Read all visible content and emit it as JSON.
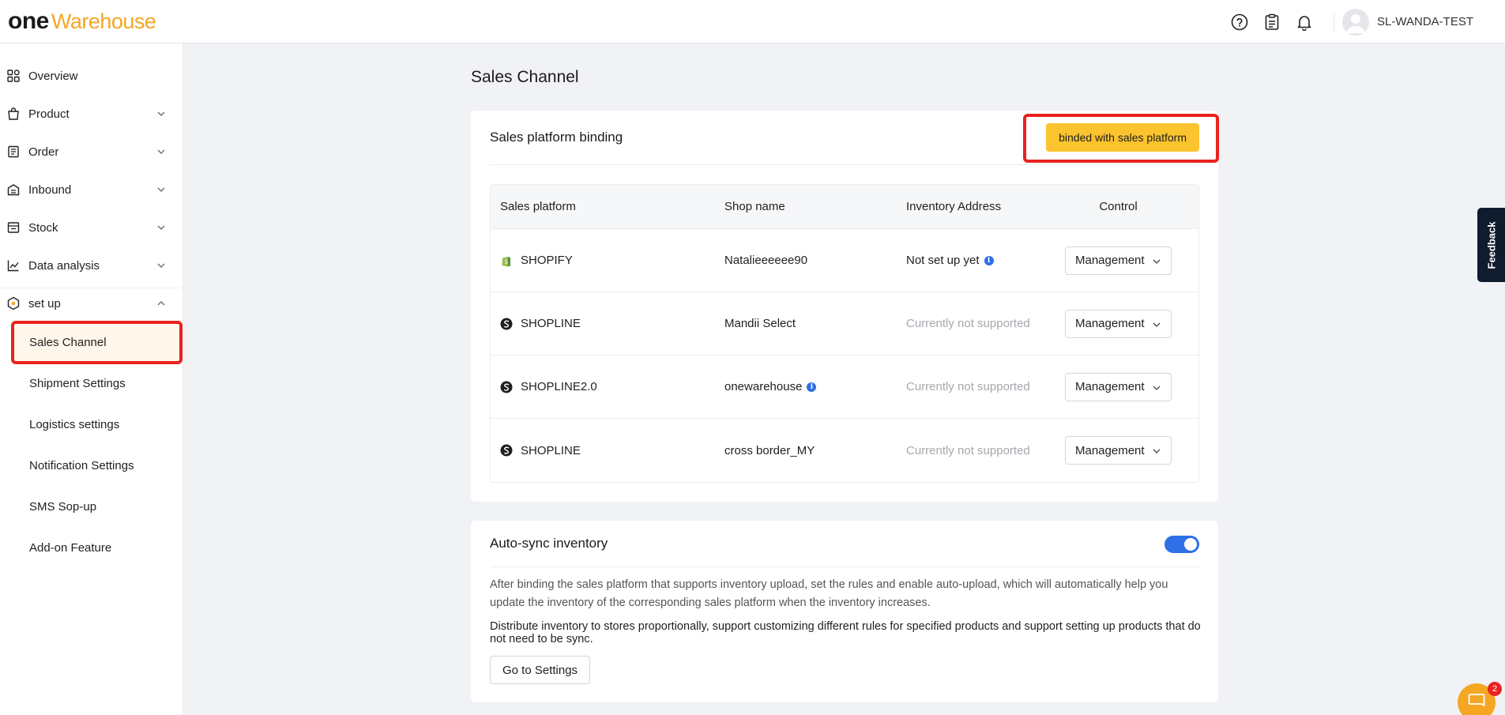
{
  "brand": {
    "logo_one": "one",
    "logo_warehouse": "Warehouse"
  },
  "header": {
    "username": "SL-WANDA-TEST"
  },
  "sidebar": {
    "items": [
      {
        "label": "Overview"
      },
      {
        "label": "Product"
      },
      {
        "label": "Order"
      },
      {
        "label": "Inbound"
      },
      {
        "label": "Stock"
      },
      {
        "label": "Data analysis"
      },
      {
        "label": "set up"
      }
    ],
    "setup_sub": [
      {
        "label": "Sales Channel"
      },
      {
        "label": "Shipment Settings"
      },
      {
        "label": "Logistics settings"
      },
      {
        "label": "Notification Settings"
      },
      {
        "label": "SMS Sop-up"
      },
      {
        "label": "Add-on Feature"
      }
    ]
  },
  "page": {
    "title": "Sales Channel"
  },
  "binding": {
    "title": "Sales platform binding",
    "button": "binded with sales platform",
    "columns": [
      "Sales platform",
      "Shop name",
      "Inventory Address",
      "Control"
    ],
    "rows": [
      {
        "platform": "SHOPIFY",
        "shop": "Natalieeeeee90",
        "inventory": "Not set up yet",
        "control": "Management"
      },
      {
        "platform": "SHOPLINE",
        "shop": "Mandii Select",
        "inventory": "Currently not supported",
        "control": "Management"
      },
      {
        "platform": "SHOPLINE2.0",
        "shop": "onewarehouse",
        "inventory": "Currently not supported",
        "control": "Management"
      },
      {
        "platform": "SHOPLINE",
        "shop": "cross border_MY",
        "inventory": "Currently not supported",
        "control": "Management"
      }
    ]
  },
  "autosync": {
    "title": "Auto-sync inventory",
    "enabled": true,
    "desc1": "After binding the sales platform that supports inventory upload, set the rules and enable auto-upload, which will automatically help you update the inventory of the corresponding sales platform when the inventory increases.",
    "desc2": "Distribute inventory to stores proportionally, support customizing different rules for specified products and support setting up products that do not need to be sync.",
    "button": "Go to Settings"
  },
  "feedback": {
    "label": "Feedback"
  },
  "chat": {
    "badge": "2"
  },
  "colors": {
    "accent": "#fbc32d",
    "highlight": "#e8231f",
    "toggle": "#2f6fe8"
  }
}
